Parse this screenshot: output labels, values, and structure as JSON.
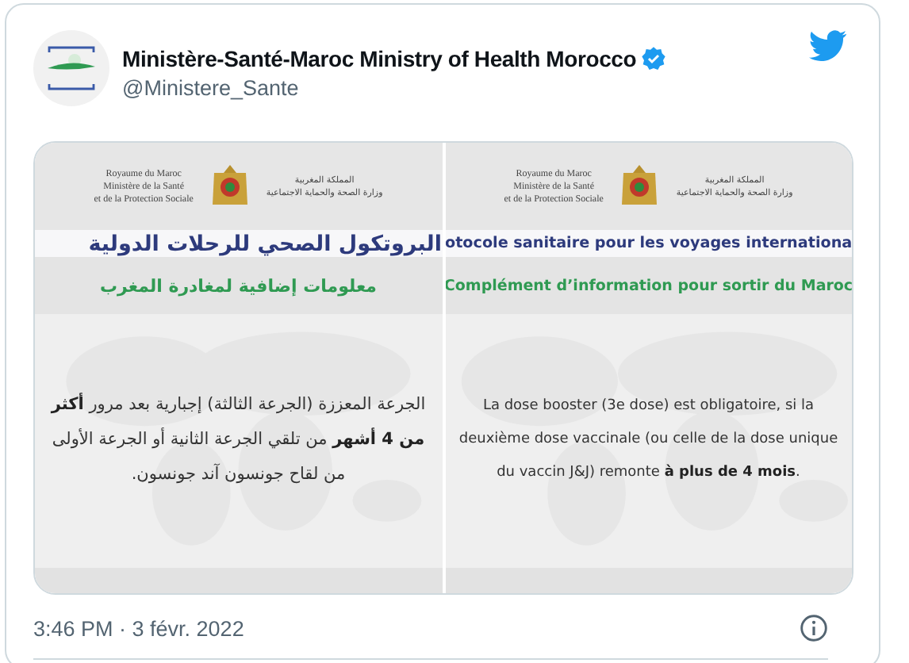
{
  "tweet": {
    "author_name": "Ministère-Santé-Maroc Ministry of Health Morocco",
    "verified": true,
    "handle": "@Ministere_Sante",
    "timestamp": "3:46 PM · 3 févr. 2022"
  },
  "media": {
    "left_image": {
      "kind": "rtl",
      "header_french": [
        "Royaume du Maroc",
        "Ministère de la Santé",
        "et de la Protection Sociale"
      ],
      "header_arabic": [
        "المملكة المغربية",
        "وزارة الصحة والحماية الاجتماعية"
      ],
      "title": "البروتكول الصحي للرحلات الدولية",
      "subtitle": "معلومات إضافية لمغادرة المغرب",
      "body": "الجرعة المعززة (الجرعة الثالثة) إجبارية بعد مرور **أكثر من 4 أشهر** من تلقي الجرعة الثانية أو الجرعة الأولى من لقاح جونسون آند جونسون."
    },
    "right_image": {
      "kind": "ltr",
      "header_french": [
        "Royaume du Maroc",
        "Ministère de la Santé",
        "et de la Protection Sociale"
      ],
      "header_arabic": [
        "المملكة المغربية",
        "وزارة الصحة والحماية الاجتماعية"
      ],
      "title": "otocole sanitaire pour les voyages internationa",
      "subtitle": "Complément d’information pour sortir du Maroc",
      "body": "La dose booster (3e dose) est obligatoire, si la deuxième dose vaccinale (ou celle de la dose unique du vaccin J&J) remonte **à plus de 4 mois**."
    }
  }
}
